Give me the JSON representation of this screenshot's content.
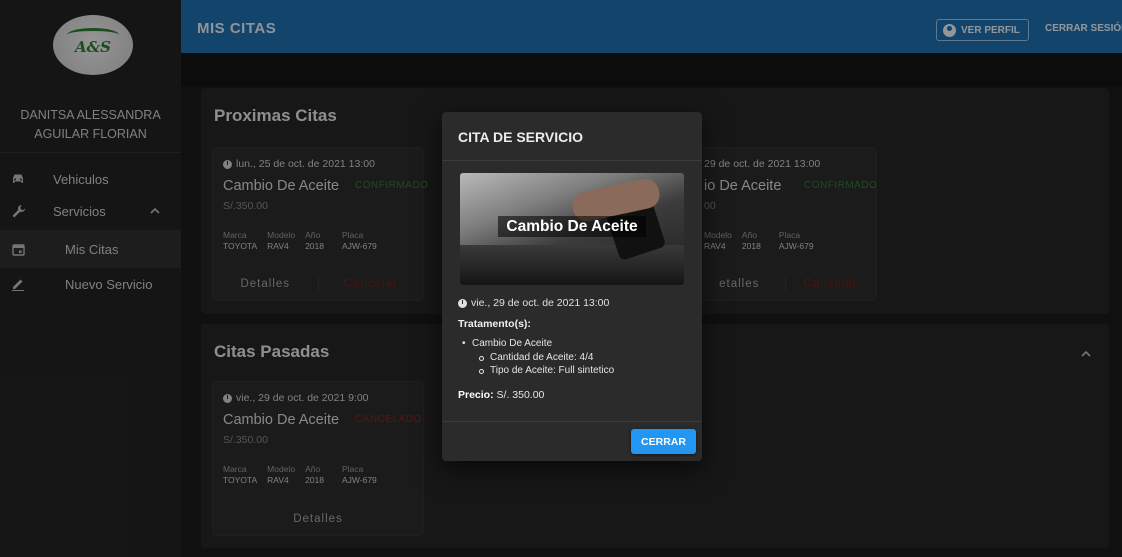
{
  "app": {
    "logo_text": "A&S",
    "user_name_line1": "DANITSA ALESSANDRA",
    "user_name_line2": "AGUILAR FLORIAN"
  },
  "sidebar": {
    "items": [
      {
        "label": "Vehiculos",
        "icon": "car-icon"
      },
      {
        "label": "Servicios",
        "icon": "wrench-icon",
        "expanded": true
      },
      {
        "label": "Mis Citas",
        "icon": "calendar-icon",
        "active": true
      },
      {
        "label": "Nuevo Servicio",
        "icon": "pencil-icon"
      }
    ]
  },
  "header": {
    "title": "MIS CITAS",
    "profile_button": "VER PERFIL",
    "logout_button": "CERRAR SESIÓN",
    "color": "#1f6fad"
  },
  "upcoming": {
    "title": "Proximas Citas",
    "cards": [
      {
        "date": "lun., 25 de oct. de 2021 13:00",
        "service": "Cambio De Aceite",
        "status": "CONFIRMADO",
        "price": "S/.350.00",
        "specs": {
          "marca_k": "Marca",
          "marca": "TOYOTA",
          "modelo_k": "Modelo",
          "modelo": "RAV4",
          "anio_k": "Año",
          "anio": "2018",
          "placa_k": "Placa",
          "placa": "AJW-679"
        },
        "details": "Detalles",
        "cancel": "Cancelar"
      },
      {
        "date": "29 de oct. de 2021 13:00",
        "service": "io De Aceite",
        "status": "CONFIRMADO",
        "price": "00",
        "specs": {
          "modelo_k": "Modelo",
          "modelo": "RAV4",
          "anio_k": "Año",
          "anio": "2018",
          "placa_k": "Placa",
          "placa": "AJW-679"
        },
        "details": "etalles",
        "cancel": "Cancelar"
      }
    ]
  },
  "past": {
    "title": "Citas Pasadas",
    "cards": [
      {
        "date": "vie., 29 de oct. de 2021 9:00",
        "service": "Cambio De Aceite",
        "status": "CANCELADO",
        "price": "S/.350.00",
        "specs": {
          "marca_k": "Marca",
          "marca": "TOYOTA",
          "modelo_k": "Modelo",
          "modelo": "RAV4",
          "anio_k": "Año",
          "anio": "2018",
          "placa_k": "Placa",
          "placa": "AJW-679"
        },
        "details": "Detalles"
      }
    ]
  },
  "modal": {
    "title": "CITA DE SERVICIO",
    "image_caption": "Cambio De Aceite",
    "date": "vie., 29 de oct. de 2021 13:00",
    "treatments_label": "Tratamento(s):",
    "treatments": [
      {
        "name": "Cambio De Aceite",
        "details": [
          "Cantidad de Aceite: 4/4",
          "Tipo de Aceite: Full sintetico"
        ]
      }
    ],
    "price_label": "Precio:",
    "price_value": "S/. 350.00",
    "close_button": "CERRAR"
  },
  "colors": {
    "confirmed": "#2e7d32",
    "cancelled": "#8e2424",
    "accent": "#2196f3"
  }
}
